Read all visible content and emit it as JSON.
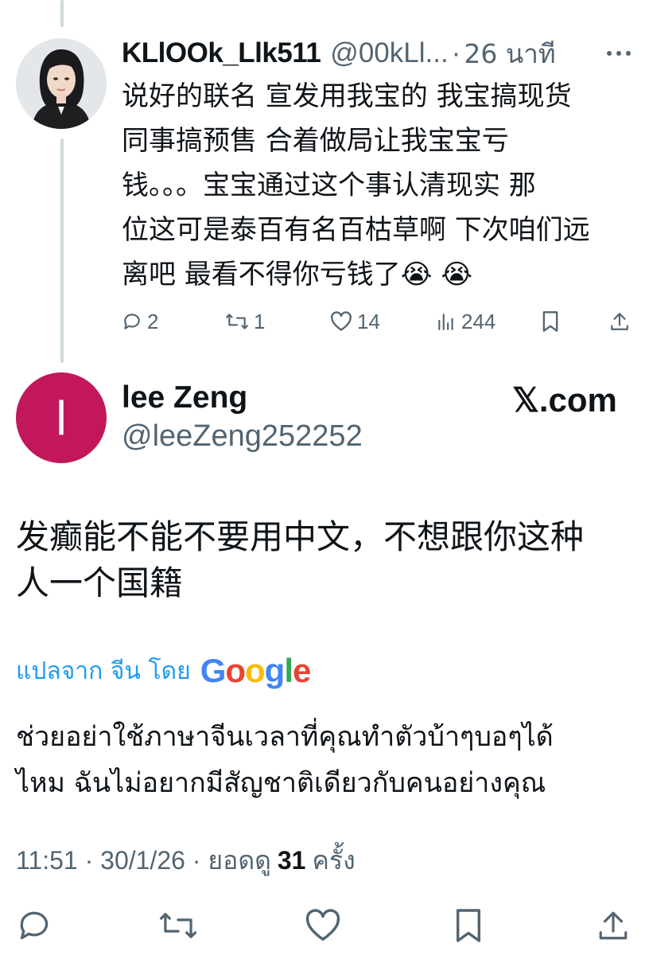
{
  "reply_tweet": {
    "display_name": "KLlOOk_Llk511",
    "handle": "@00kLl...",
    "time_ago": "26 นาที",
    "text_lines": [
      "说好的联名 宣发用我宝的 我宝搞现货",
      "同事搞预售 合着做局让我宝宝亏",
      "钱。。。宝宝通过这个事认清现实 那",
      "位这可是泰百有名百枯草啊 下次咱们远",
      "离吧 最看不得你亏钱了😭 😭"
    ],
    "actions": {
      "replies": "2",
      "reposts": "1",
      "likes": "14",
      "views": "244"
    },
    "icons": [
      "more-icon",
      "reply-icon",
      "repost-icon",
      "like-icon",
      "views-icon",
      "bookmark-icon",
      "share-icon"
    ]
  },
  "main_tweet": {
    "avatar_letter": "l",
    "display_name": "lee Zeng",
    "handle": "@leeZeng252252",
    "brand": "𝕏.com",
    "text_lines": [
      "发癫能不能不要用中文，不想跟你这种",
      "人一个国籍"
    ],
    "translate_label": "แปลจาก จีน โดย",
    "translator": "Google",
    "translated_lines": [
      "ช่วยอย่าใช้ภาษาจีนเวลาที่คุณทำตัวบ้าๆบอๆได้",
      "ไหม ฉันไม่อยากมีสัญชาติเดียวกับคนอย่างคุณ"
    ],
    "meta": {
      "time": "11:51",
      "date": "30/1/26",
      "views_label": "ยอดดู",
      "views_count": "31",
      "views_suffix": "ครั้ง"
    }
  },
  "colors": {
    "text": "#0f1419",
    "secondary": "#536471",
    "link": "#1d9bf0",
    "avatar_bg": "#c2185b",
    "thread_line": "#cfd9de"
  }
}
